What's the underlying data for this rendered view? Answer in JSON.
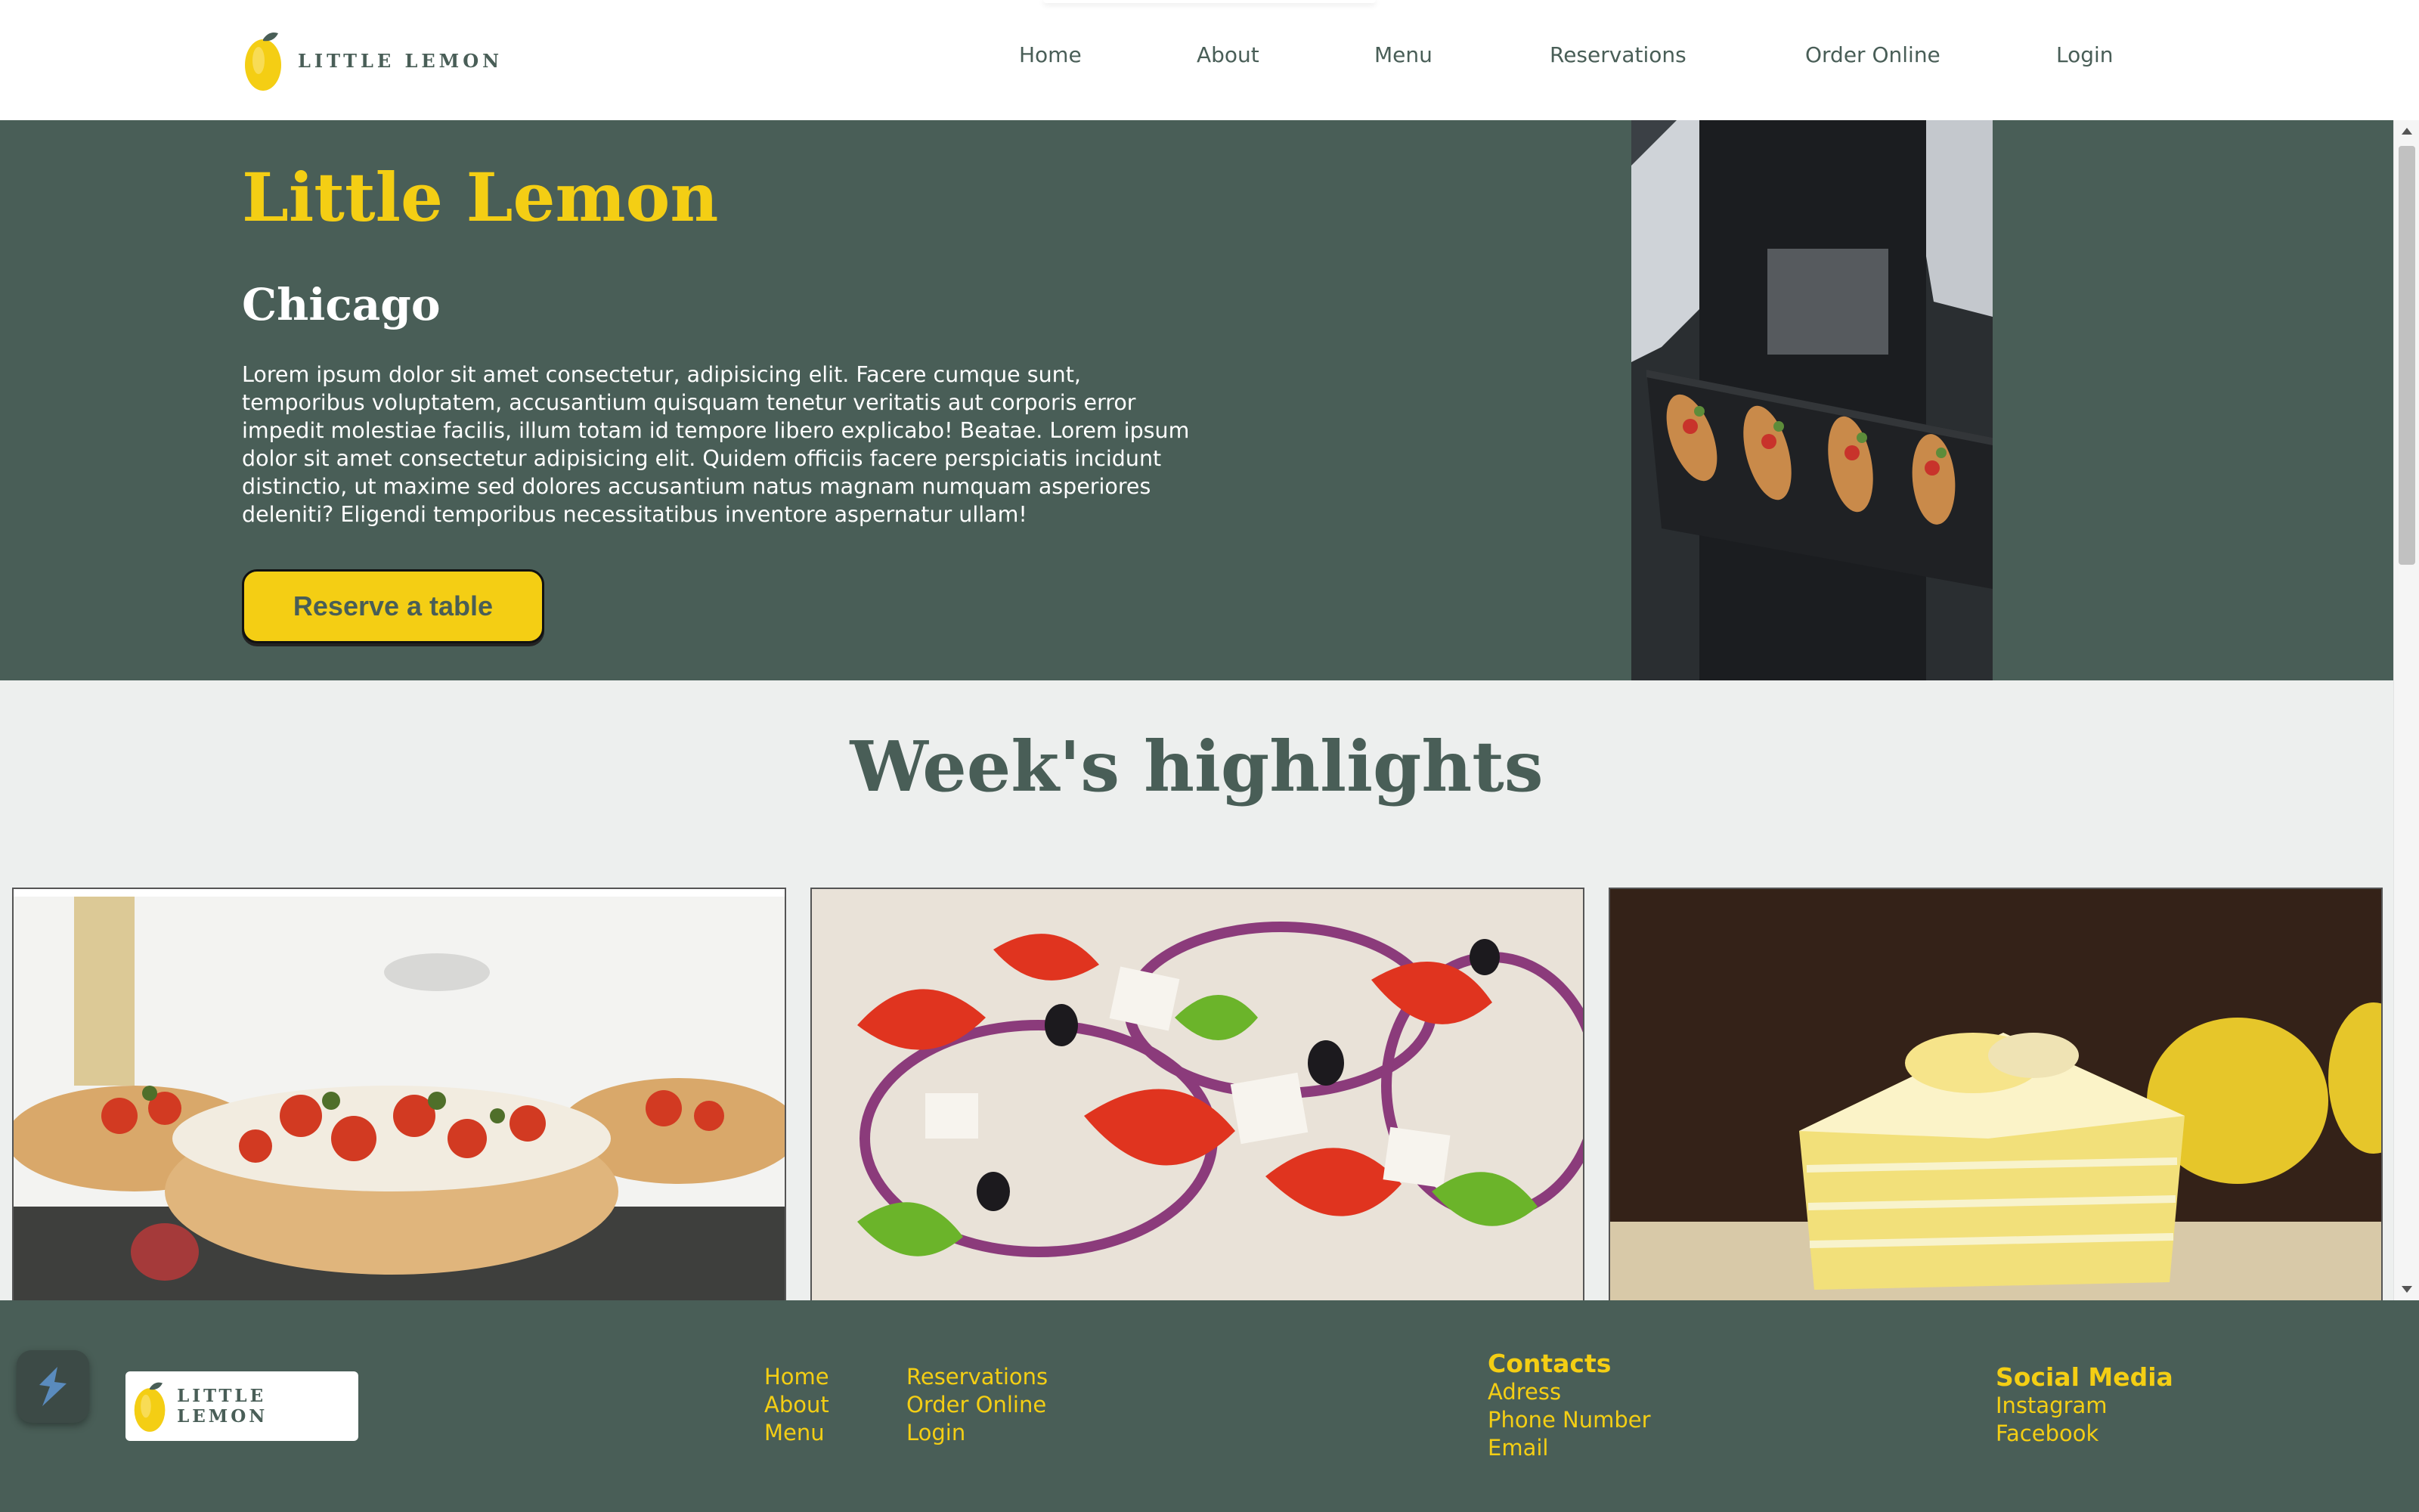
{
  "header": {
    "logo_text": "LITTLE LEMON",
    "nav": [
      "Home",
      "About",
      "Menu",
      "Reservations",
      "Order Online",
      "Login"
    ]
  },
  "hero": {
    "title": "Little Lemon",
    "subtitle": "Chicago",
    "description": "Lorem ipsum dolor sit amet consectetur, adipisicing elit. Facere cumque sunt, temporibus voluptatem, accusantium quisquam tenetur veritatis aut corporis error impedit molestiae facilis, illum totam id tempore libero explicabo! Beatae. Lorem ipsum dolor sit amet consectetur adipisicing elit. Quidem officiis facere perspiciatis incidunt distinctio, ut maxime sed dolores accusantium natus magnam numquam asperiores deleniti? Eligendi temporibus necessitatibus inventore aspernatur ullam!",
    "button_label": "Reserve a table"
  },
  "highlights": {
    "title": "Week's highlights"
  },
  "footer": {
    "logo_text": "LITTLE LEMON",
    "nav_col1": [
      "Home",
      "About",
      "Menu"
    ],
    "nav_col2": [
      "Reservations",
      "Order Online",
      "Login"
    ],
    "contacts": {
      "heading": "Contacts",
      "items": [
        "Adress",
        "Phone Number",
        "Email"
      ]
    },
    "social": {
      "heading": "Social Media",
      "items": [
        "Instagram",
        "Facebook"
      ]
    }
  },
  "colors": {
    "primary_green": "#495e57",
    "primary_yellow": "#f4ce14",
    "highlight_bg": "#edefee"
  },
  "icons": [
    "lemon-icon",
    "extension-icon",
    "scroll-up-icon",
    "scroll-down-icon"
  ]
}
